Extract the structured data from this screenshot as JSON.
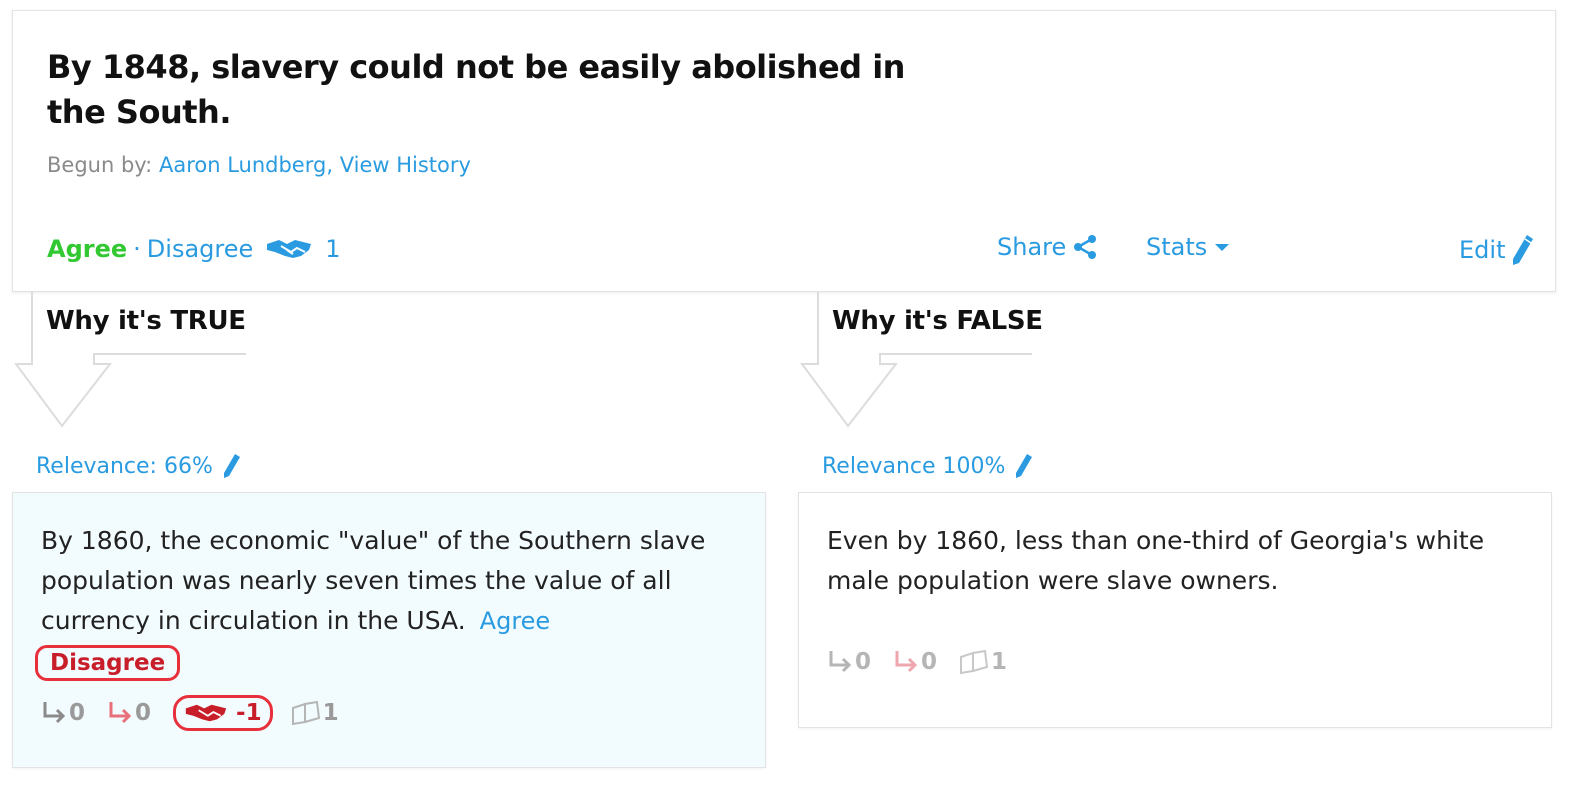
{
  "claim": {
    "title": "By 1848, slavery could not be easily abolished in the South.",
    "begun_label": "Begun by:",
    "author": "Aaron Lundberg",
    "separator": ",",
    "history_link": "View History",
    "agree_label": "Agree",
    "dot": "·",
    "disagree_label": "Disagree",
    "agreement_count": "1",
    "share_label": "Share",
    "stats_label": "Stats",
    "edit_label": "Edit"
  },
  "columns": {
    "true": {
      "heading": "Why it's TRUE",
      "relevance": "Relevance: 66%",
      "reason": {
        "text": "By 1860, the economic \"value\" of the Southern slave population was nearly seven times the value of all currency in circulation in the USA.",
        "agree_label": "Agree",
        "disagree_label": "Disagree",
        "supporting_count": "0",
        "opposing_count": "0",
        "agreement_count": "-1",
        "sources_count": "1"
      }
    },
    "false": {
      "heading": "Why it's FALSE",
      "relevance": "Relevance 100%",
      "reason": {
        "text": "Even by 1860, less than one-third of Georgia's white male population were slave owners.",
        "supporting_count": "0",
        "opposing_count": "0",
        "sources_count": "1"
      }
    }
  },
  "colors": {
    "link_blue": "#2a9be0",
    "agree_green": "#32c832",
    "disagree_red": "#c81e2a",
    "highlight_red": "#e8303c",
    "reason_bg": "#f2fbfe"
  },
  "icons": [
    "handshake-icon",
    "share-icon",
    "caret-down-icon",
    "pencil-icon",
    "reply-arrow-icon",
    "book-icon",
    "down-arrow-icon"
  ]
}
